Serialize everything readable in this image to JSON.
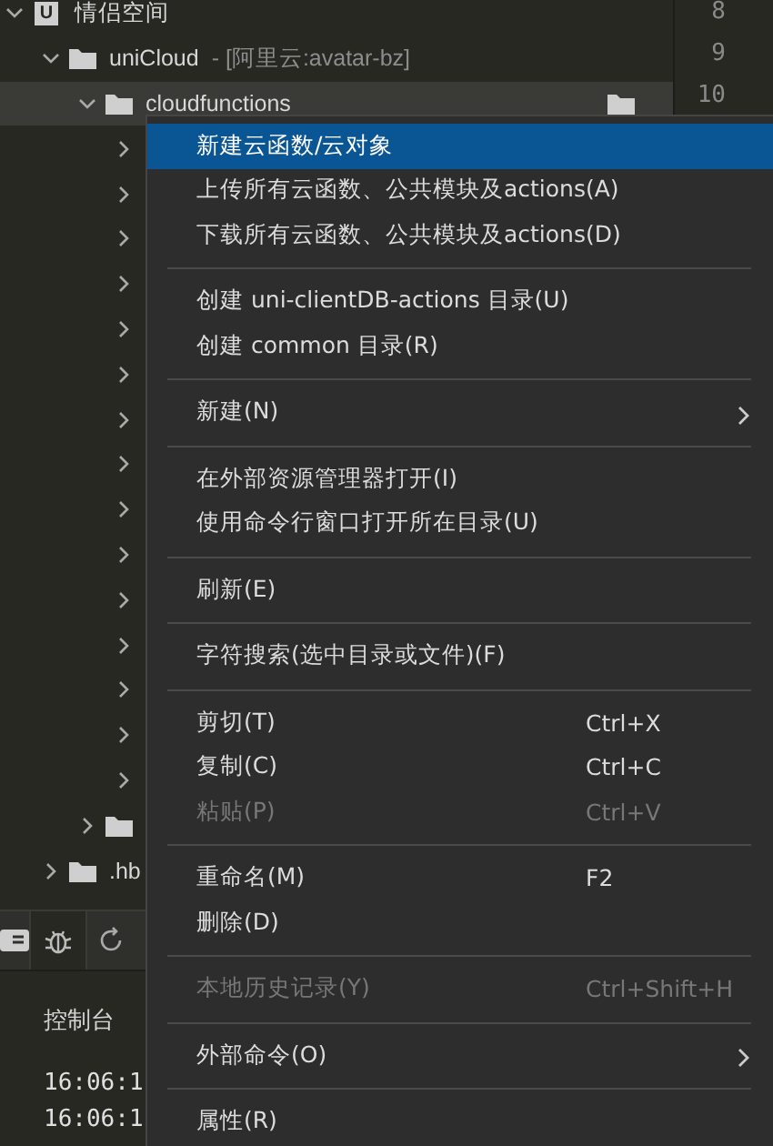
{
  "tree": [
    {
      "label": "情侣空间",
      "kind": "project",
      "icon_letter": "U",
      "expanded": true,
      "selected": false,
      "children": [
        {
          "label": "uniCloud",
          "note": "- [阿里云:avatar-bz]",
          "kind": "folder",
          "expanded": true,
          "selected": false,
          "children": [
            {
              "label": "cloudfunctions",
              "kind": "folder",
              "expanded": true,
              "selected": true,
              "children": [
                {
                  "expanded": false,
                  "selected": false
                },
                {
                  "expanded": false,
                  "selected": false
                },
                {
                  "expanded": false,
                  "selected": false
                },
                {
                  "expanded": false,
                  "selected": false
                },
                {
                  "expanded": false,
                  "selected": false
                },
                {
                  "expanded": false,
                  "selected": false
                },
                {
                  "expanded": false,
                  "selected": false
                },
                {
                  "expanded": false,
                  "selected": false
                },
                {
                  "expanded": false,
                  "selected": false
                },
                {
                  "expanded": false,
                  "selected": false
                },
                {
                  "expanded": false,
                  "selected": false
                },
                {
                  "expanded": false,
                  "selected": false
                },
                {
                  "expanded": false,
                  "selected": false
                },
                {
                  "expanded": false,
                  "selected": false
                },
                {
                  "expanded": false,
                  "selected": false
                }
              ]
            },
            {
              "kind": "folder",
              "expanded": false,
              "selected": false
            }
          ]
        },
        {
          "label": ".hb",
          "kind": "folder",
          "expanded": false,
          "selected": false
        }
      ]
    }
  ],
  "gutter": {
    "line_numbers": [
      "8",
      "9",
      "10"
    ]
  },
  "bottom_panel": {
    "console_label": "控制台",
    "console_lines": [
      "16:06:1",
      "16:06:1"
    ]
  },
  "context_menu": [
    {
      "kind": "item",
      "label": "新建云函数/云对象",
      "selected": true,
      "disabled": false
    },
    {
      "kind": "item",
      "label": "上传所有云函数、公共模块及actions(A)",
      "selected": false,
      "disabled": false
    },
    {
      "kind": "item",
      "label": "下载所有云函数、公共模块及actions(D)",
      "selected": false,
      "disabled": false
    },
    {
      "kind": "separator"
    },
    {
      "kind": "item",
      "label": "创建 uni-clientDB-actions 目录(U)",
      "selected": false,
      "disabled": false
    },
    {
      "kind": "item",
      "label": "创建 common 目录(R)",
      "selected": false,
      "disabled": false
    },
    {
      "kind": "separator"
    },
    {
      "kind": "submenu",
      "label": "新建(N)",
      "selected": false,
      "disabled": false
    },
    {
      "kind": "separator"
    },
    {
      "kind": "item",
      "label": "在外部资源管理器打开(I)",
      "selected": false,
      "disabled": false
    },
    {
      "kind": "item",
      "label": "使用命令行窗口打开所在目录(U)",
      "selected": false,
      "disabled": false
    },
    {
      "kind": "separator"
    },
    {
      "kind": "item",
      "label": "刷新(E)",
      "selected": false,
      "disabled": false
    },
    {
      "kind": "separator"
    },
    {
      "kind": "item",
      "label": "字符搜索(选中目录或文件)(F)",
      "selected": false,
      "disabled": false
    },
    {
      "kind": "separator"
    },
    {
      "kind": "item",
      "label": "剪切(T)",
      "shortcut": "Ctrl+X",
      "selected": false,
      "disabled": false
    },
    {
      "kind": "item",
      "label": "复制(C)",
      "shortcut": "Ctrl+C",
      "selected": false,
      "disabled": false
    },
    {
      "kind": "item",
      "label": "粘贴(P)",
      "shortcut": "Ctrl+V",
      "selected": false,
      "disabled": true
    },
    {
      "kind": "separator"
    },
    {
      "kind": "item",
      "label": "重命名(M)",
      "shortcut": "F2",
      "selected": false,
      "disabled": false
    },
    {
      "kind": "item",
      "label": "删除(D)",
      "selected": false,
      "disabled": false
    },
    {
      "kind": "separator"
    },
    {
      "kind": "item",
      "label": "本地历史记录(Y)",
      "shortcut": "Ctrl+Shift+H",
      "selected": false,
      "disabled": true
    },
    {
      "kind": "separator"
    },
    {
      "kind": "submenu",
      "label": "外部命令(O)",
      "selected": false,
      "disabled": false
    },
    {
      "kind": "separator"
    },
    {
      "kind": "item",
      "label": "属性(R)",
      "selected": false,
      "disabled": false
    }
  ]
}
